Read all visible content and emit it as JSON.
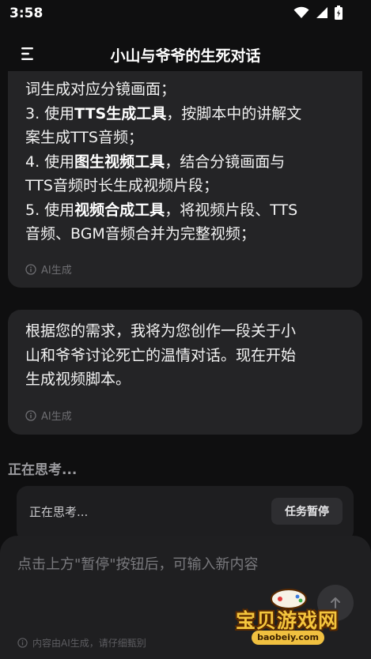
{
  "status_bar": {
    "time": "3:58"
  },
  "header": {
    "title": "小山与爷爷的生死对话"
  },
  "messages": [
    {
      "lines": [
        {
          "parts": [
            {
              "text": "词生成对应分镜画面；"
            }
          ]
        },
        {
          "parts": [
            {
              "text": "3. 使用"
            },
            {
              "text": "TTS生成工具",
              "bold": true
            },
            {
              "text": "，按脚本中的讲解文"
            }
          ]
        },
        {
          "parts": [
            {
              "text": "案生成TTS音频；"
            }
          ]
        },
        {
          "parts": [
            {
              "text": "4. 使用"
            },
            {
              "text": "图生视频工具",
              "bold": true
            },
            {
              "text": "，结合分镜画面与"
            }
          ]
        },
        {
          "parts": [
            {
              "text": "TTS音频时长生成视频片段；"
            }
          ]
        },
        {
          "parts": [
            {
              "text": "5. 使用"
            },
            {
              "text": "视频合成工具",
              "bold": true
            },
            {
              "text": "，将视频片段、TTS"
            }
          ]
        },
        {
          "parts": [
            {
              "text": "音频、BGM音频合并为完整视频；"
            }
          ]
        }
      ],
      "ai_label": "AI生成"
    },
    {
      "lines": [
        {
          "parts": [
            {
              "text": "根据您的需求，我将为您创作一段关于小"
            }
          ]
        },
        {
          "parts": [
            {
              "text": "山和爷爷讨论死亡的温情对话。现在开始"
            }
          ]
        },
        {
          "parts": [
            {
              "text": "生成视频脚本。"
            }
          ]
        }
      ],
      "ai_label": "AI生成"
    }
  ],
  "thinking": {
    "header": "正在思考...",
    "card_text": "正在思考...",
    "pause_button": "任务暂停"
  },
  "input": {
    "placeholder": "点击上方\"暂停\"按钮后，可输入新内容",
    "footer_note": "内容由AI生成，请仔细甄别"
  },
  "watermark": {
    "title": "宝贝游戏网",
    "url": "baobeiy.com"
  }
}
